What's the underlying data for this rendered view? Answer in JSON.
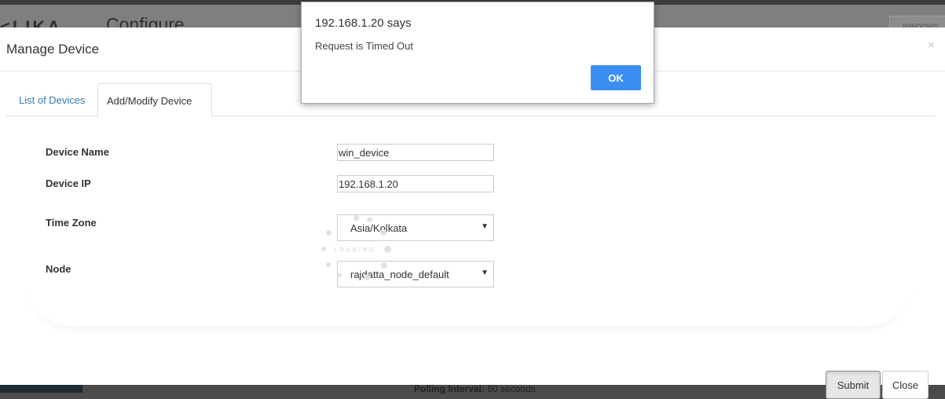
{
  "background": {
    "logo_text": "<LIKA",
    "page_title": "Configure",
    "window_button_label": "WINDOWS",
    "footer_label": "Polling Interval:",
    "footer_value": "60 seconds"
  },
  "modal": {
    "title": "Manage Device",
    "close_symbol": "×",
    "tabs": [
      {
        "label": "List of Devices",
        "active": false
      },
      {
        "label": "Add/Modify Device",
        "active": true
      }
    ],
    "fields": {
      "device_name": {
        "label": "Device Name",
        "value": "win_device"
      },
      "device_ip": {
        "label": "Device IP",
        "value": "192.168.1.20"
      },
      "time_zone": {
        "label": "Time Zone",
        "value": "Asia/Kolkata"
      },
      "node": {
        "label": "Node",
        "value": "rajdatta_node_default"
      }
    },
    "loader_text": "LOADING",
    "buttons": {
      "submit_label": "Submit",
      "close_label": "Close"
    }
  },
  "alert": {
    "title": "192.168.1.20 says",
    "message": "Request is Timed Out",
    "ok_label": "OK"
  },
  "colors": {
    "primary_blue": "#3b8ef0",
    "tab_link": "#337ab7"
  },
  "icons": {
    "select_caret": "triangle-down-icon",
    "close": "close-icon"
  }
}
